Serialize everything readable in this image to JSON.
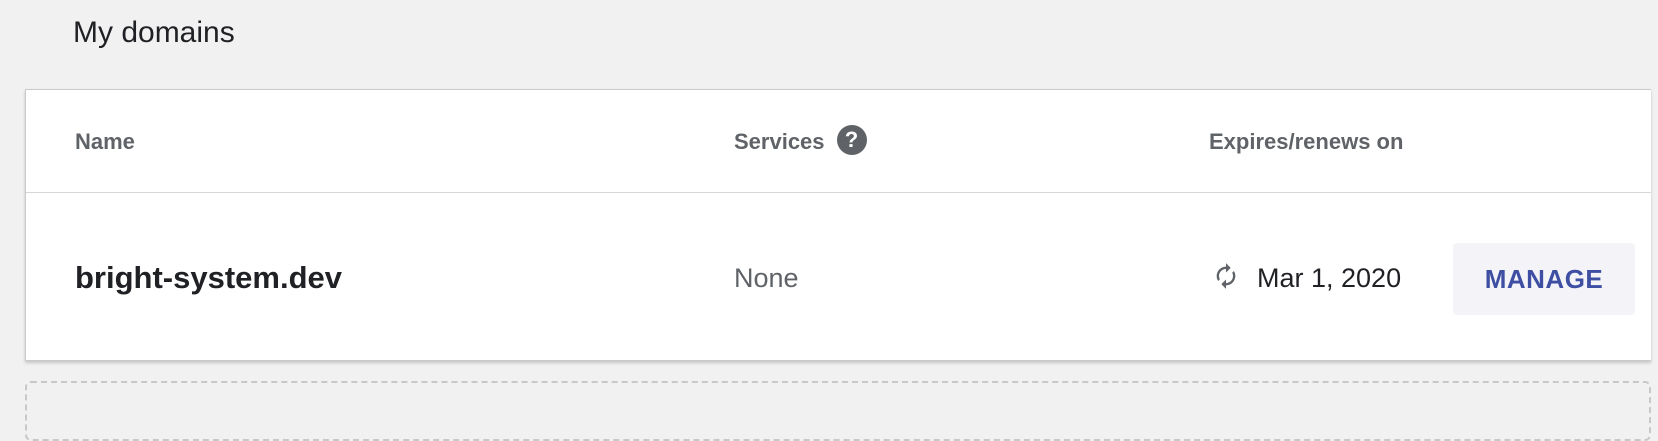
{
  "page": {
    "title": "My domains"
  },
  "table": {
    "headers": {
      "name": "Name",
      "services": "Services",
      "expires": "Expires/renews on"
    },
    "help_icon": "help-circle-icon",
    "rows": [
      {
        "name": "bright-system.dev",
        "services": "None",
        "renew_icon": "autorenew-icon",
        "expires": "Mar 1, 2020",
        "action_label": "MANAGE"
      }
    ]
  },
  "colors": {
    "background": "#f1f1f1",
    "card": "#ffffff",
    "header_text": "#5f6368",
    "accent": "#3d4ea3",
    "button_bg": "#f4f4f8"
  }
}
